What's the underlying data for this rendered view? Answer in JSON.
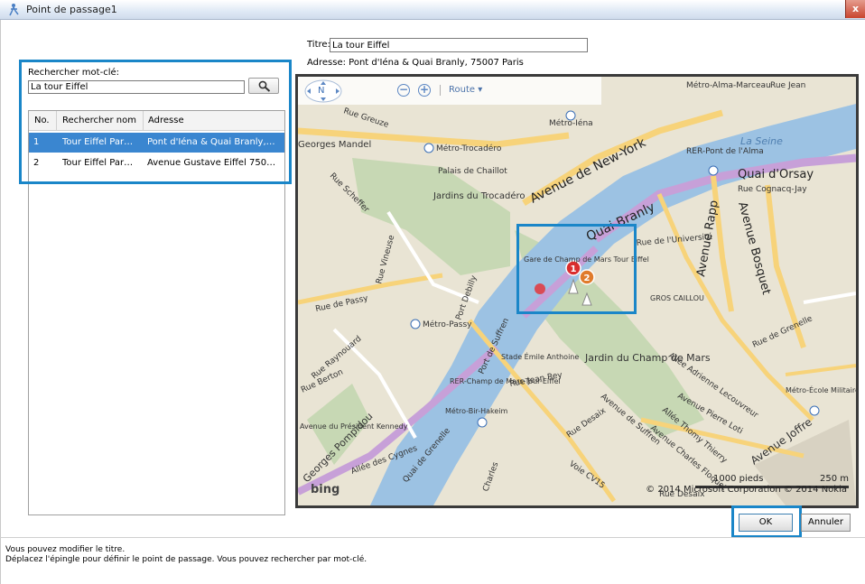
{
  "window": {
    "title": "Point de passage1",
    "close_label": "x"
  },
  "search": {
    "label": "Rechercher mot-clé:",
    "value": "La tour Eiffel"
  },
  "results": {
    "columns": [
      "No.",
      "Rechercher nom",
      "Adresse"
    ],
    "rows": [
      {
        "no": "1",
        "name": "Tour Eiffel Par…",
        "address": "Pont d'Iéna & Quai Branly,…",
        "selected": true
      },
      {
        "no": "2",
        "name": "Tour Eiffel Par…",
        "address": "Avenue Gustave Eiffel 750…",
        "selected": false
      }
    ]
  },
  "titre": {
    "label": "Titre:",
    "value": "La tour Eiffel"
  },
  "adresse": {
    "text": "Adresse: Pont d'Iéna & Quai Branly, 75007 Paris"
  },
  "map": {
    "toolbar": {
      "compass_label": "N",
      "route_label": "Route ▾"
    },
    "labels": {
      "metro_alma": "Métro-Alma-Marceau",
      "rue_jean": "Rue Jean",
      "metro_iena": "Métro-Iéna",
      "georges_mandel": "Georges Mandel",
      "metro_trocadero": "Métro-Trocadéro",
      "rue_greuze": "Rue Greuze",
      "la_seine": "La Seine",
      "rer_pont": "RER-Pont de l'Alma",
      "quai_orsay": "Quai d'Orsay",
      "avenue_new_york": "Avenue de New-York",
      "rue_cognacq": "Rue Cognacq-Jay",
      "palais": "Palais de Chaillot",
      "jardins": "Jardins du Trocadéro",
      "rue_scheffer": "Rue Scheffer",
      "quai_branly": "Quai Branly",
      "rue_universite": "Rue de l'Université",
      "avenue_rapp": "Avenue Rapp",
      "avenue_bosquet": "Avenue Bosquet",
      "rue_vineuse": "Rue Vineuse",
      "gare_champ": "Gare de Champ de Mars Tour Eiffel",
      "gros_caillou": "GROS CAILLOU",
      "rue_passy": "Rue de Passy",
      "port_debilly": "Port Debilly",
      "metro_passy": "Métro-Passy",
      "port_suffren": "Port de Suffren",
      "rue_raynouard": "Rue Raynouard",
      "stade": "Stade Émile Anthoine",
      "jardin_champ": "Jardin du Champ de Mars",
      "rue_grenelle": "Rue de Grenelle",
      "rue_berton": "Rue Berton",
      "rer_champ": "RER-Champ de Mars-Tour-Eiffel",
      "rue_jean_rey": "Rue Jean Rey",
      "allee_adrienne": "Allée Adrienne Lecouvreur",
      "metro_ecole": "Métro-École Militaire",
      "metro_bir": "Métro-Bir-Hakeim",
      "avenue_pierre_loti": "Avenue Pierre Loti",
      "rue_desaix": "Rue Desaix",
      "avenue_suffren": "Avenue de Suffren",
      "allee_thomy": "Allée Thomy Thierry",
      "avenue_charles": "Avenue Charles Floquet",
      "avenue_joffre": "Avenue Joffre",
      "avenue_pres": "Avenue du Président Kennedy",
      "georges_pompidou": "Georges Pompidou",
      "quai_grenelle": "Quai de Grenelle",
      "allee_cygnes": "Allée des Cygnes",
      "voie_cv": "Voie CV15",
      "rue_charles": "Charles",
      "rue_desaix2": "Rue Desaix"
    },
    "pins": [
      "1",
      "2"
    ],
    "scale": {
      "feet": "1000 pieds",
      "meters": "250 m"
    },
    "copyright": "© 2014 Microsoft Corporation   © 2014 Nokia",
    "brand": "bing"
  },
  "buttons": {
    "ok": "OK",
    "cancel": "Annuler"
  },
  "help": {
    "line1": "Vous pouvez modifier le titre.",
    "line2": "Déplacez l'épingle pour définir le point de passage. Vous pouvez rechercher par mot-clé."
  }
}
